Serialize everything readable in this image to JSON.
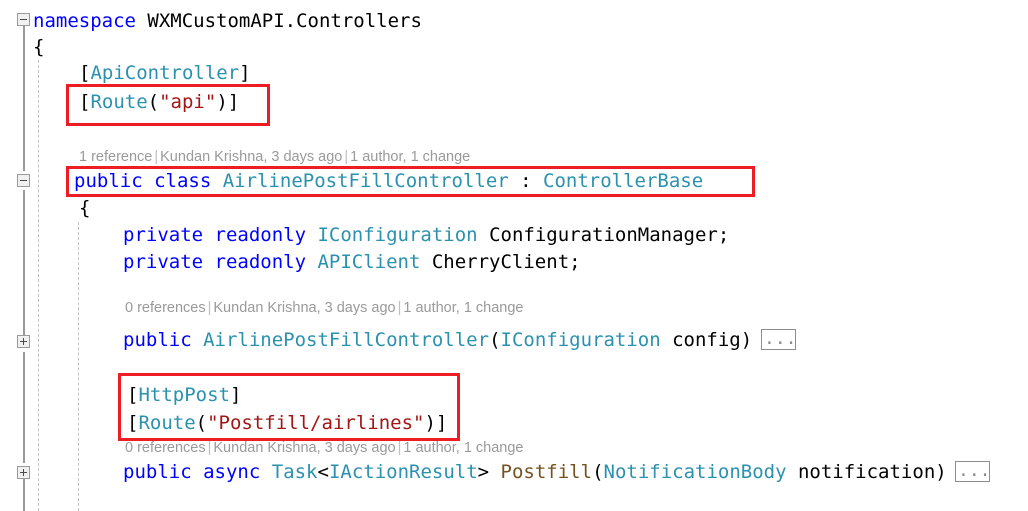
{
  "editor": {
    "background": "#ffffff",
    "colors": {
      "keyword": "#0000ff",
      "type": "#2b91af",
      "string": "#a31515",
      "method": "#74531f",
      "plain": "#000000",
      "codelens": "#9a9a9a",
      "annotation": "#ee1c25",
      "outline": "#9a9a9a",
      "indent_guide": "#c4c4c4"
    }
  },
  "code": {
    "namespace_keyword": "namespace",
    "namespace_name": " WXMCustomAPI.Controllers",
    "open_brace_namespace": "{",
    "attr_api_controller": {
      "lb": "[",
      "name": "ApiController",
      "rb": "]"
    },
    "attr_route_api": {
      "lb": "[",
      "name": "Route",
      "lp": "(",
      "arg": "\"api\"",
      "rp": ")",
      "rb": "]"
    },
    "class_decl": {
      "modifier": "public",
      "keyword": " class",
      "name": " AirlinePostFillController",
      "colon": " : ",
      "base": "ControllerBase"
    },
    "open_brace_class": "{",
    "field_configuration": {
      "modifier": "private",
      "readonly": " readonly",
      "type": " IConfiguration",
      "name": " ConfigurationManager;"
    },
    "field_cherryclient": {
      "modifier": "private",
      "readonly": " readonly",
      "type": " APIClient",
      "name": " CherryClient;"
    },
    "ctor_decl": {
      "modifier": "public",
      "name": " AirlinePostFillController",
      "lp": "(",
      "ptype": "IConfiguration",
      "pname": " config",
      "rp": ")"
    },
    "ctor_collapsed": "...",
    "attr_http_post": {
      "lb": "[",
      "name": "HttpPost",
      "rb": "]"
    },
    "attr_route_postfill": {
      "lb": "[",
      "name": "Route",
      "lp": "(",
      "arg": "\"Postfill/airlines\"",
      "rp": ")",
      "rb": "]"
    },
    "method_decl": {
      "modifier": "public",
      "async": " async",
      "rtype": " Task",
      "lt": "<",
      "generic": "IActionResult",
      "gt": "> ",
      "name": "Postfill",
      "lp": "(",
      "ptype": "NotificationBody",
      "pname": " notification",
      "rp": ")"
    },
    "method_collapsed": "..."
  },
  "codelens": {
    "class_lens": {
      "references": "1 reference",
      "author_date": "Kundan Krishna, 3 days ago",
      "changes": "1 author, 1 change"
    },
    "ctor_lens": {
      "references": "0 references",
      "author_date": "Kundan Krishna, 3 days ago",
      "changes": "1 author, 1 change"
    },
    "method_lens": {
      "references": "0 references",
      "author_date": "Kundan Krishna, 3 days ago",
      "changes": "1 author, 1 change"
    },
    "separator": "|"
  },
  "outlining": {
    "namespace_toggle": "collapse",
    "class_toggle": "collapse",
    "ctor_toggle": "expand",
    "method_toggle": "expand"
  },
  "annotations": [
    {
      "label": "route-api-attribute-highlight"
    },
    {
      "label": "class-declaration-highlight"
    },
    {
      "label": "httppost-route-attributes-highlight"
    }
  ]
}
